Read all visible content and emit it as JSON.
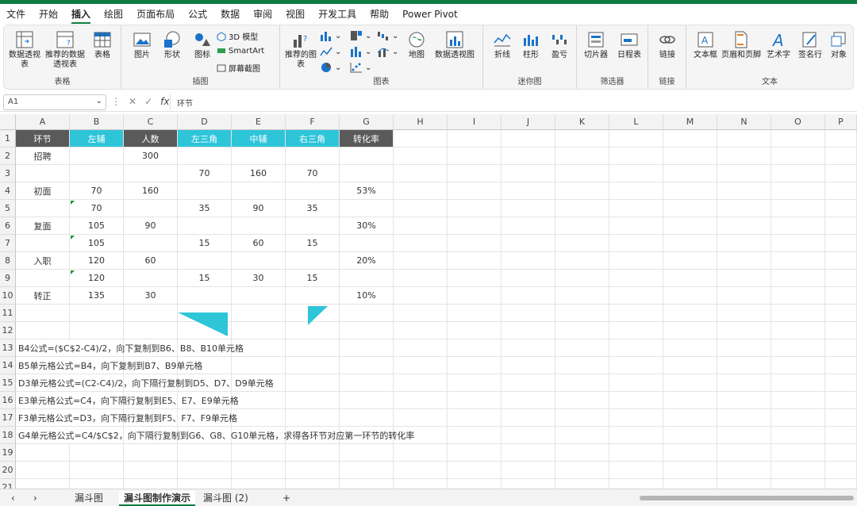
{
  "menu": [
    "文件",
    "开始",
    "插入",
    "绘图",
    "页面布局",
    "公式",
    "数据",
    "审阅",
    "视图",
    "开发工具",
    "帮助",
    "Power Pivot"
  ],
  "active_menu": "插入",
  "ribbon": {
    "groups": {
      "tables": "表格",
      "illustrations": "插图",
      "charts": "图表",
      "sparklines": "迷你图",
      "filters": "筛选器",
      "links": "链接",
      "text": "文本"
    },
    "buttons": {
      "pivot": "数据透视表",
      "pivot_sub": "",
      "rec_pivot": "推荐的数据透视表",
      "table": "表格",
      "pictures": "图片",
      "shapes": "形状",
      "icons": "图标",
      "model3d": "3D 模型",
      "smartart": "SmartArt",
      "screenshot": "屏幕截图",
      "rec_charts": "推荐的图表",
      "map": "地图",
      "pivot_chart": "数据透视图",
      "line": "折线",
      "column": "柱形",
      "winloss": "盈亏",
      "slicer": "切片器",
      "timeline": "日程表",
      "link": "链接",
      "textbox": "文本框",
      "header_footer": "页眉和页脚",
      "wordart": "艺术字",
      "signature": "签名行",
      "object": "对象"
    }
  },
  "formula_bar": {
    "name_box": "A1",
    "content": "环节"
  },
  "columns": [
    "A",
    "B",
    "C",
    "D",
    "E",
    "F",
    "G",
    "H",
    "I",
    "J",
    "K",
    "L",
    "M",
    "N",
    "O",
    "P"
  ],
  "rows": [
    "1",
    "2",
    "3",
    "4",
    "5",
    "6",
    "7",
    "8",
    "9",
    "10",
    "11",
    "12",
    "13",
    "14",
    "15",
    "16",
    "17",
    "18",
    "19",
    "20",
    "21"
  ],
  "header_row": [
    "环节",
    "左辅",
    "人数",
    "左三角",
    "中辅",
    "右三角",
    "转化率"
  ],
  "table": [
    [
      "招聘",
      "",
      "300",
      "",
      "",
      "",
      ""
    ],
    [
      "",
      "",
      "",
      "70",
      "160",
      "70",
      ""
    ],
    [
      "初面",
      "70",
      "160",
      "",
      "",
      "",
      "53%"
    ],
    [
      "",
      "70",
      "",
      "35",
      "90",
      "35",
      ""
    ],
    [
      "复面",
      "105",
      "90",
      "",
      "",
      "",
      "30%"
    ],
    [
      "",
      "105",
      "",
      "15",
      "60",
      "15",
      ""
    ],
    [
      "入职",
      "120",
      "60",
      "",
      "",
      "",
      "20%"
    ],
    [
      "",
      "120",
      "",
      "15",
      "30",
      "15",
      ""
    ],
    [
      "转正",
      "135",
      "30",
      "",
      "",
      "",
      "10%"
    ]
  ],
  "notes": [
    "B4公式=($C$2-C4)/2，向下复制到B6、B8、B10单元格",
    "B5单元格公式=B4，向下复制到B7、B9单元格",
    "D3单元格公式=(C2-C4)/2，向下隔行复制到D5、D7、D9单元格",
    "E3单元格公式=C4，向下隔行复制到E5、E7、E9单元格",
    "F3单元格公式=D3，向下隔行复制到F5、F7、F9单元格",
    "G4单元格公式=C4/$C$2，向下隔行复制到G6、G8、G10单元格，求得各环节对应第一环节的转化率"
  ],
  "sheet_tabs": [
    "漏斗图",
    "漏斗图制作演示",
    "漏斗图 (2)"
  ],
  "active_tab": "漏斗图制作演示",
  "colors": {
    "accent": "#107c41",
    "header_dark": "#5a5a5a",
    "header_cyan": "#2ec5d9"
  }
}
